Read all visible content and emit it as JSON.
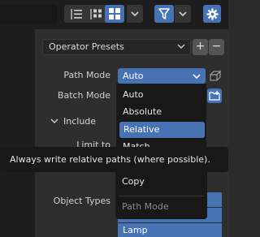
{
  "header": {
    "filter_icon": "filter-icon",
    "settings_icon": "gear-icon"
  },
  "panel": {
    "presets_label": "Operator Presets",
    "presets_add": "+",
    "presets_remove": "−",
    "path_mode_label": "Path Mode",
    "path_mode_value": "Auto",
    "batch_mode_label": "Batch Mode",
    "include_label": "Include",
    "limit_to_label": "Limit to",
    "object_types_label": "Object Types"
  },
  "dropdown": {
    "items": [
      "Auto",
      "Absolute",
      "Relative",
      "Match"
    ],
    "active_index": 2
  },
  "tooltip": {
    "text": "Always write relative paths (where possible)."
  },
  "context_menu": {
    "copy": "Copy",
    "path_mode": "Path Mode"
  },
  "object_types": {
    "lamp": "Lamp"
  },
  "colors": {
    "accent": "#4772b3",
    "panel_bg": "#2e2e2e",
    "menu_bg": "#181818"
  }
}
